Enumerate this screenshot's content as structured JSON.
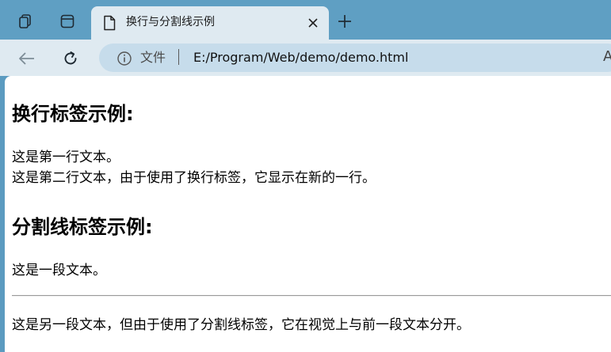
{
  "browser": {
    "tab": {
      "title": "换行与分割线示例",
      "close_glyph": "✕"
    },
    "new_tab_glyph": "+",
    "address_bar": {
      "scheme_label": "文件",
      "url": "E:/Program/Web/demo/demo.html",
      "reader_glyph": "A"
    }
  },
  "page": {
    "heading_1": "换行标签示例:",
    "line_1": "这是第一行文本。",
    "line_2": "这是第二行文本，由于使用了换行标签，它显示在新的一行。",
    "heading_2": "分割线标签示例:",
    "paragraph_1": "这是一段文本。",
    "paragraph_2": "这是另一段文本，但由于使用了分割线标签，它在视觉上与前一段文本分开。"
  },
  "colors": {
    "tab_strip": "#5f9fc3",
    "toolbar": "#dfeaf1",
    "address_bar": "#c6dceb",
    "page_background": "#ffffff"
  }
}
